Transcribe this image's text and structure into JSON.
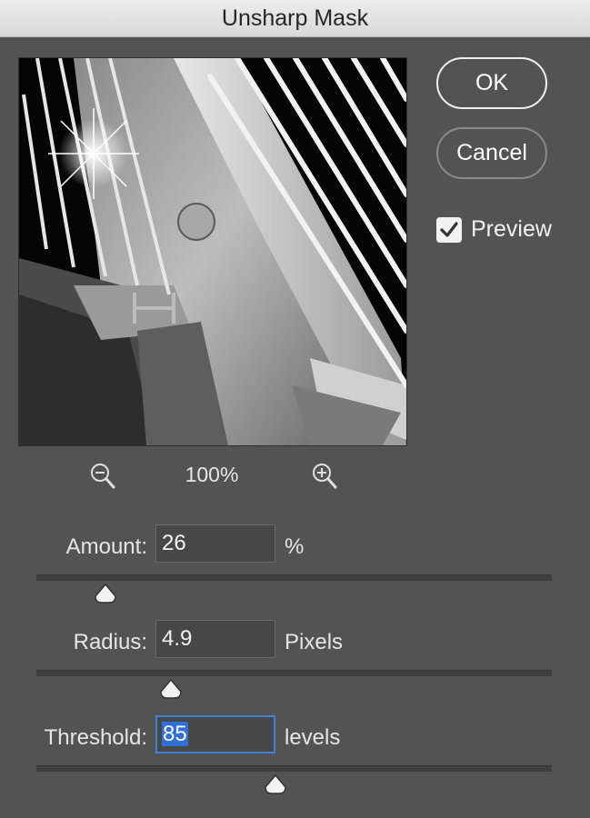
{
  "window": {
    "title": "Unsharp Mask"
  },
  "buttons": {
    "ok": "OK",
    "cancel": "Cancel"
  },
  "preview_checkbox": {
    "label": "Preview",
    "checked": true
  },
  "zoom": {
    "level": "100%",
    "zoom_out_icon": "zoom-out-icon",
    "zoom_in_icon": "zoom-in-icon"
  },
  "controls": {
    "amount": {
      "label": "Amount:",
      "value": "26",
      "unit": "%"
    },
    "radius": {
      "label": "Radius:",
      "value": "4.9",
      "unit": "Pixels"
    },
    "threshold": {
      "label": "Threshold:",
      "value": "85",
      "unit": "levels"
    }
  },
  "colors": {
    "dialog_bg": "#535353",
    "focus_ring": "#3b84d6",
    "selection": "#2f6fd6"
  }
}
